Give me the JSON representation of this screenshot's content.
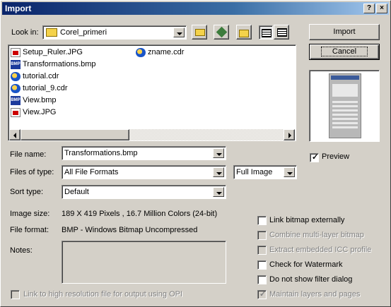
{
  "window": {
    "title": "Import",
    "help_btn": "?",
    "close_btn": "×"
  },
  "look_in": {
    "label": "Look in:",
    "value": "Corel_primeri"
  },
  "toolbar": {
    "up_icon": "folder-up-icon",
    "favorites_icon": "favorites-icon",
    "new_folder_icon": "new-folder-icon",
    "list_view_icon": "list-view-icon",
    "details_view_icon": "details-view-icon"
  },
  "files": [
    {
      "name": "Setup_Ruler.JPG",
      "type": "jpg"
    },
    {
      "name": "Transformations.bmp",
      "type": "bmp"
    },
    {
      "name": "tutorial.cdr",
      "type": "cdr"
    },
    {
      "name": "tutorial_9.cdr",
      "type": "cdr"
    },
    {
      "name": "View.bmp",
      "type": "bmp"
    },
    {
      "name": "View.JPG",
      "type": "jpg"
    },
    {
      "name": "zname.cdr",
      "type": "cdr"
    }
  ],
  "buttons": {
    "import": "Import",
    "cancel": "Cancel"
  },
  "preview": {
    "label": "Preview",
    "checked": true
  },
  "file_name": {
    "label": "File name:",
    "value": "Transformations.bmp"
  },
  "files_of_type": {
    "label": "Files of type:",
    "value": "All File Formats"
  },
  "full_image": {
    "value": "Full Image"
  },
  "sort_type": {
    "label": "Sort type:",
    "value": "Default"
  },
  "image_size": {
    "label": "Image size:",
    "value": "189 X 419 Pixels , 16.7 Million Colors (24-bit)"
  },
  "file_format": {
    "label": "File format:",
    "value": "BMP - Windows Bitmap Uncompressed"
  },
  "notes": {
    "label": "Notes:"
  },
  "options": [
    {
      "label": "Link bitmap externally",
      "enabled": true,
      "checked": false
    },
    {
      "label": "Combine multi-layer bitmap",
      "enabled": false,
      "checked": false
    },
    {
      "label": "Extract embedded ICC profile",
      "enabled": false,
      "checked": false
    },
    {
      "label": "Check for Watermark",
      "enabled": true,
      "checked": false
    },
    {
      "label": "Do not show filter dialog",
      "enabled": true,
      "checked": false
    },
    {
      "label": "Maintain layers and pages",
      "enabled": false,
      "checked": true
    }
  ],
  "link_high_res": {
    "label": "Link to high resolution file for output using OPI",
    "enabled": false
  }
}
